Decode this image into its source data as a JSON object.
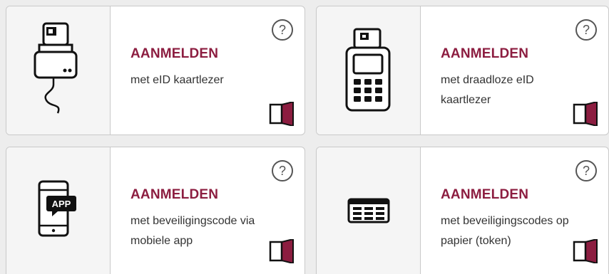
{
  "accent_color": "#8c1d40",
  "cards": [
    {
      "icon": "eid-card-reader-icon",
      "title": "AANMELDEN",
      "subtitle": "met eID kaartlezer",
      "help": "?"
    },
    {
      "icon": "wireless-card-reader-icon",
      "title": "AANMELDEN",
      "subtitle": "met draadloze eID kaartlezer",
      "help": "?"
    },
    {
      "icon": "mobile-app-icon",
      "title": "AANMELDEN",
      "subtitle": "met beveiligingscode via mobiele app",
      "app_label": "APP",
      "help": "?"
    },
    {
      "icon": "token-card-icon",
      "title": "AANMELDEN",
      "subtitle": "met beveiligingscodes op papier (token)",
      "help": "?"
    }
  ]
}
